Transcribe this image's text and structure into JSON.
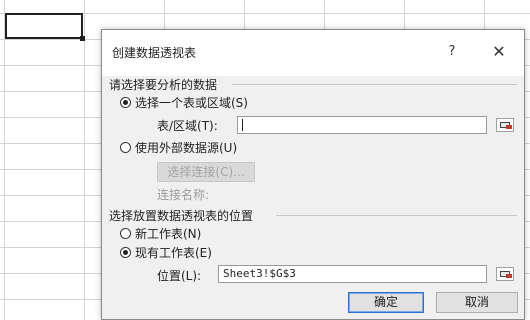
{
  "dialog": {
    "title": "创建数据透视表",
    "help": "?",
    "close": "✕"
  },
  "source_section": {
    "title": "请选择要分析的数据",
    "option_select_range": "选择一个表或区域(S)",
    "table_range_label": "表/区域(T):",
    "table_range_value": "",
    "option_external": "使用外部数据源(U)",
    "choose_connection": "选择连接(C)...",
    "connection_name_label": "连接名称:"
  },
  "location_section": {
    "title": "选择放置数据透视表的位置",
    "option_new_sheet": "新工作表(N)",
    "option_existing_sheet": "现有工作表(E)",
    "location_label": "位置(L):",
    "location_value": "Sheet3!$G$3"
  },
  "buttons": {
    "ok": "确定",
    "cancel": "取消"
  },
  "state": {
    "source_selected": "select_range",
    "location_selected": "existing_sheet"
  }
}
